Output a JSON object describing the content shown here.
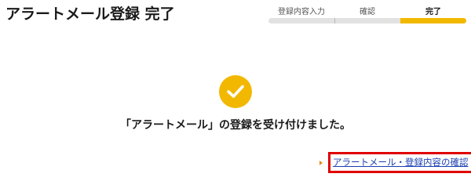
{
  "header": {
    "title": "アラートメール登録 完了"
  },
  "steps": {
    "items": [
      {
        "label": "登録内容入力",
        "current": false
      },
      {
        "label": "確認",
        "current": false
      },
      {
        "label": "完了",
        "current": true
      }
    ]
  },
  "main": {
    "status_icon": "checkmark-icon",
    "message": "「アラートメール」の登録を受け付けました。",
    "confirm_link": {
      "label": "アラートメール・登録内容の確認",
      "bullet_icon": "triangle-right-icon"
    }
  },
  "colors": {
    "accent": "#f2b800",
    "step_inactive": "#e2e2e2",
    "link": "#1a3fb0",
    "link_bullet": "#e8890c",
    "highlight_border": "#e00000"
  }
}
